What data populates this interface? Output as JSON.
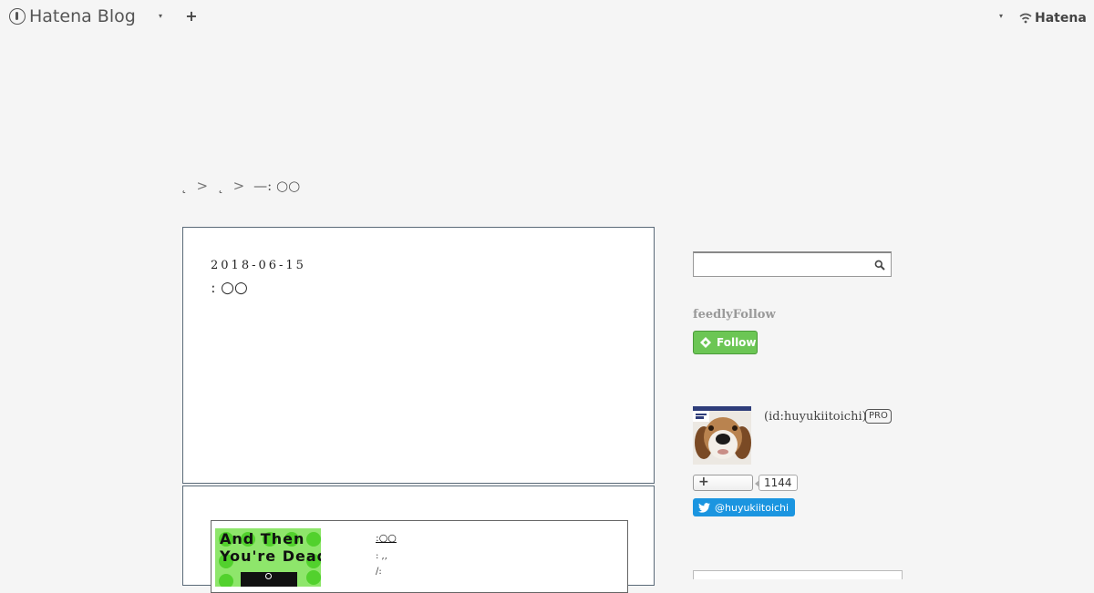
{
  "header": {
    "brand": "Hatena Blog",
    "brand_caret": "▾",
    "add_label": "+",
    "account_caret": "▾",
    "hatena_label": "Hatena"
  },
  "breadcrumb": {
    "items": [
      "˛",
      "˛",
      "—: ○○"
    ],
    "separator": ">"
  },
  "article": {
    "date": "2018-06-15",
    "title": "ː ○○"
  },
  "embed": {
    "thumb_line1": "And Then",
    "thumb_line2": "You're Dead",
    "title": "ː○○",
    "meta1": ":   ,,",
    "meta2": "/:"
  },
  "sidebar": {
    "search": {
      "placeholder": "",
      "value": ""
    },
    "feedly_heading": "feedlyFollow",
    "feedly_button": "Follow",
    "user_id": "(id:huyukiitoichi)",
    "pro_badge": "PRO",
    "subscribe_plus": "+",
    "subscriber_count": "1144",
    "twitter_handle": "@huyukiitoichi"
  },
  "colors": {
    "feedly_green": "#6cc655",
    "twitter_blue": "#1b95e0",
    "thumb_green": "#8ee66b"
  }
}
